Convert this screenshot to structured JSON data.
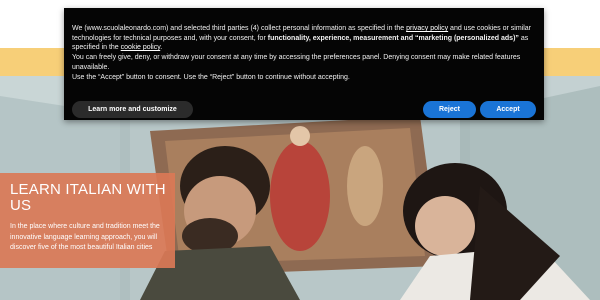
{
  "cookie_banner": {
    "line1_pre": "We (www.scuolaleonardo.com) and selected third parties (4) collect personal information as specified in the ",
    "privacy_link": "privacy policy",
    "line1_mid": " and use cookies or similar technologies for technical purposes and, with your consent, for ",
    "purposes_bold": "functionality, experience, measurement and “marketing (personalized ads)”",
    "line1_post": " as specified in the ",
    "cookie_link": "cookie policy",
    "line1_end": ".",
    "line2": "You can freely give, deny, or withdraw your consent at any time by accessing the preferences panel. Denying consent may make related features unavailable.",
    "line3": "Use the “Accept” button to consent. Use the “Reject” button to continue without accepting.",
    "learn_more_label": "Learn more and customize",
    "reject_label": "Reject",
    "accept_label": "Accept"
  },
  "hero": {
    "title": "LEARN ITALIAN WITH US",
    "text": "In the place where culture and tradition meet the innovative language learning approach, you will discover five of the most beautiful Italian cities"
  },
  "colors": {
    "yellow_bar": "#f7cf78",
    "info_box": "#da7856",
    "button_blue": "#1a74d6",
    "banner_bg": "#050505"
  }
}
